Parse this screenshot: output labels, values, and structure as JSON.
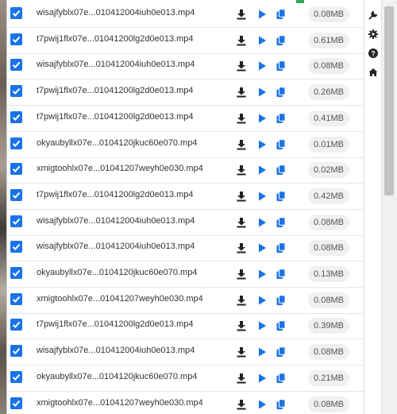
{
  "colors": {
    "accent": "#1a73e8",
    "icon_dark": "#222222"
  },
  "sidebar": {
    "icons": [
      "wrench-icon",
      "gear-icon",
      "help-icon",
      "home-icon"
    ]
  },
  "downloads": [
    {
      "name": "wisajfyblx07e...010412004iuh0e013.mp4",
      "size": "0.08MB",
      "checked": true
    },
    {
      "name": "t7pwij1flx07e...01041200lg2d0e013.mp4",
      "size": "0.61MB",
      "checked": true
    },
    {
      "name": "wisajfyblx07e...010412004iuh0e013.mp4",
      "size": "0.08MB",
      "checked": true
    },
    {
      "name": "t7pwij1flx07e...01041200lg2d0e013.mp4",
      "size": "0.26MB",
      "checked": true
    },
    {
      "name": "t7pwij1flx07e...01041200lg2d0e013.mp4",
      "size": "0.41MB",
      "checked": true
    },
    {
      "name": "okyaubyllx07e...0104120jkuc60e070.mp4",
      "size": "0.01MB",
      "checked": true
    },
    {
      "name": "xmigtoohlx07e...01041207weyh0e030.mp4",
      "size": "0.02MB",
      "checked": true
    },
    {
      "name": "t7pwij1flx07e...01041200lg2d0e013.mp4",
      "size": "0.42MB",
      "checked": true
    },
    {
      "name": "wisajfyblx07e...010412004iuh0e013.mp4",
      "size": "0.08MB",
      "checked": true
    },
    {
      "name": "wisajfyblx07e...010412004iuh0e013.mp4",
      "size": "0.08MB",
      "checked": true
    },
    {
      "name": "okyaubyllx07e...0104120jkuc60e070.mp4",
      "size": "0.13MB",
      "checked": true
    },
    {
      "name": "xmigtoohlx07e...01041207weyh0e030.mp4",
      "size": "0.08MB",
      "checked": true
    },
    {
      "name": "t7pwij1flx07e...01041200lg2d0e013.mp4",
      "size": "0.39MB",
      "checked": true
    },
    {
      "name": "wisajfyblx07e...010412004iuh0e013.mp4",
      "size": "0.08MB",
      "checked": true
    },
    {
      "name": "okyaubyllx07e...0104120jkuc60e070.mp4",
      "size": "0.21MB",
      "checked": true
    },
    {
      "name": "xmigtoohlx07e...01041207weyh0e030.mp4",
      "size": "0.08MB",
      "checked": true
    }
  ]
}
